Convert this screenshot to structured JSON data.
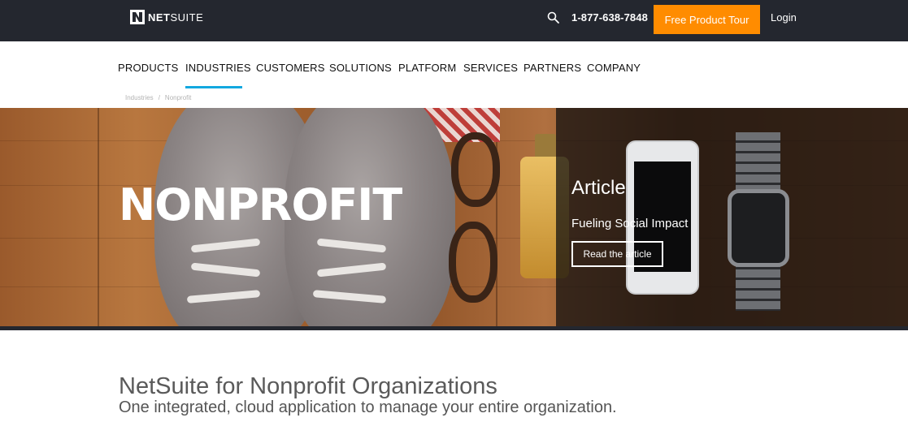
{
  "topbar": {
    "logo": {
      "bold": "NET",
      "regular": "SUITE",
      "icon": "netsuite-n-logo-icon"
    },
    "search_icon": "search-icon",
    "phone": "1-877-638-7848",
    "tour_button": "Free Product Tour",
    "login": "Login",
    "colors": {
      "background": "#24272f",
      "accent": "#ff8c00"
    }
  },
  "nav": {
    "items": [
      {
        "label": "PRODUCTS"
      },
      {
        "label": "INDUSTRIES"
      },
      {
        "label": "CUSTOMERS"
      },
      {
        "label": "SOLUTIONS"
      },
      {
        "label": "PLATFORM"
      },
      {
        "label": "SERVICES"
      },
      {
        "label": "PARTNERS"
      },
      {
        "label": "COMPANY"
      }
    ],
    "active_label": "INDUSTRIES",
    "active_color": "#12a8e0"
  },
  "breadcrumb": {
    "items": [
      {
        "label": "Industries"
      },
      {
        "label": "Nonprofit"
      }
    ],
    "separator": "/"
  },
  "hero": {
    "title": "NONPROFIT",
    "article_label": "Article",
    "article_title": "Fueling Social Impact",
    "read_button": "Read the article"
  },
  "content": {
    "title": "NetSuite for Nonprofit Organizations",
    "subtitle": "One integrated, cloud application to manage your entire organization."
  }
}
